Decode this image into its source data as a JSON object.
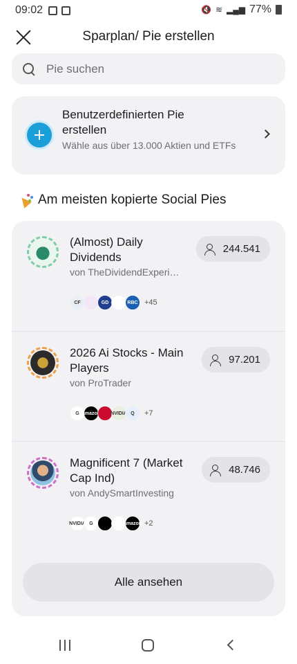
{
  "status_bar": {
    "time": "09:02",
    "battery": "77%"
  },
  "header": {
    "title": "Sparplan/ Pie erstellen"
  },
  "search": {
    "placeholder": "Pie suchen"
  },
  "create": {
    "title": "Benutzerdefinierten Pie erstellen",
    "subtitle": "Wähle aus über 13.000 Aktien und ETFs"
  },
  "section": {
    "title": "Am meisten kopierte Social Pies"
  },
  "pies": [
    {
      "title": "(Almost) Daily Dividends",
      "author": "von TheDividendExperi…",
      "copies": "244.541",
      "logos": [
        {
          "icon": "cf-logo",
          "label": "CF",
          "color": "#e9eef5"
        },
        {
          "icon": "hand-logo",
          "label": "",
          "color": "#f3e7f7"
        },
        {
          "icon": "gd-logo",
          "label": "GD",
          "color": "#1f3e8f"
        },
        {
          "icon": "microsoft-logo",
          "label": "",
          "color": "#ffffff"
        },
        {
          "icon": "rbc-logo",
          "label": "RBC",
          "color": "#1b5fb4"
        }
      ],
      "more": "+45"
    },
    {
      "title": "2026 Ai Stocks - Main Players",
      "author": "von ProTrader",
      "copies": "97.201",
      "logos": [
        {
          "icon": "google-logo",
          "label": "G",
          "color": "#ffffff"
        },
        {
          "icon": "amazon-logo",
          "label": "amazon",
          "color": "#000000"
        },
        {
          "icon": "broadcom-logo",
          "label": "",
          "color": "#cc092f"
        },
        {
          "icon": "nvidia-logo",
          "label": "NVIDIA",
          "color": "#e8efe0"
        },
        {
          "icon": "qualcomm-logo",
          "label": "Q",
          "color": "#e7eefb"
        }
      ],
      "more": "+7"
    },
    {
      "title": "Magnificent 7 (Market Cap Ind)",
      "author": "von AndySmartInvesting",
      "copies": "48.746",
      "logos": [
        {
          "icon": "nvidia-logo",
          "label": "NVIDIA",
          "color": "#ffffff"
        },
        {
          "icon": "google-logo",
          "label": "G",
          "color": "#ffffff"
        },
        {
          "icon": "apple-logo",
          "label": "",
          "color": "#000000"
        },
        {
          "icon": "microsoft-logo",
          "label": "",
          "color": "#ffffff"
        },
        {
          "icon": "amazon-logo",
          "label": "amazon",
          "color": "#000000"
        }
      ],
      "more": "+2"
    }
  ],
  "see_all": {
    "label": "Alle ansehen"
  },
  "colors": {
    "accent": "#1a9fd9",
    "card_bg": "#f2f2f5",
    "pill_bg": "#e4e4e8"
  }
}
